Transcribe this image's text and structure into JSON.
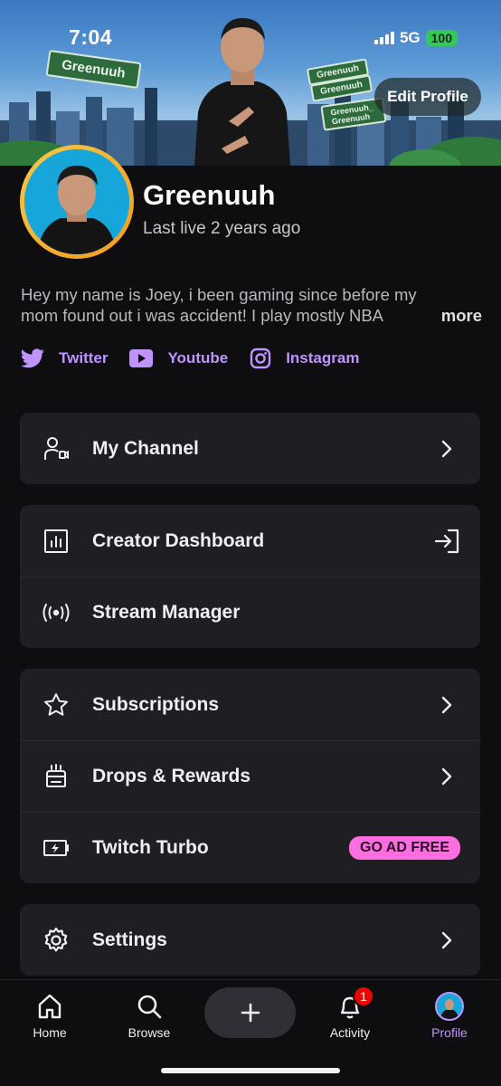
{
  "status_bar": {
    "time": "7:04",
    "network": "5G",
    "battery": "100"
  },
  "banner": {
    "sign_main": "Greenuuh",
    "sign_youtube": "Greenuuh",
    "sign_instagram": "Greenuuh",
    "sign_twitter": "Greenuuh_ Greenuuh",
    "edit_profile_label": "Edit Profile"
  },
  "profile": {
    "display_name": "Greenuuh",
    "last_live": "Last live 2 years ago",
    "bio_line1": "Hey my name is Joey, i been gaming since before my",
    "bio_line2": "mom found out i was accident! I play mostly NBA",
    "bio_more": "more"
  },
  "socials": [
    {
      "label": "Twitter",
      "icon": "twitter-icon"
    },
    {
      "label": "Youtube",
      "icon": "youtube-icon"
    },
    {
      "label": "Instagram",
      "icon": "instagram-icon"
    }
  ],
  "menu": {
    "my_channel": "My Channel",
    "creator_dashboard": "Creator Dashboard",
    "stream_manager": "Stream Manager",
    "subscriptions": "Subscriptions",
    "drops_rewards": "Drops & Rewards",
    "twitch_turbo": "Twitch Turbo",
    "go_ad_free": "GO AD FREE",
    "settings": "Settings"
  },
  "bottom_nav": {
    "home": "Home",
    "browse": "Browse",
    "activity": "Activity",
    "activity_badge": "1",
    "profile": "Profile"
  },
  "colors": {
    "accent": "#bf94ff",
    "background": "#0e0e10",
    "card": "#1f1f23",
    "ad_free_badge": "#ff6ee0",
    "avatar_ring": "#f7c948",
    "notification": "#eb0400"
  }
}
